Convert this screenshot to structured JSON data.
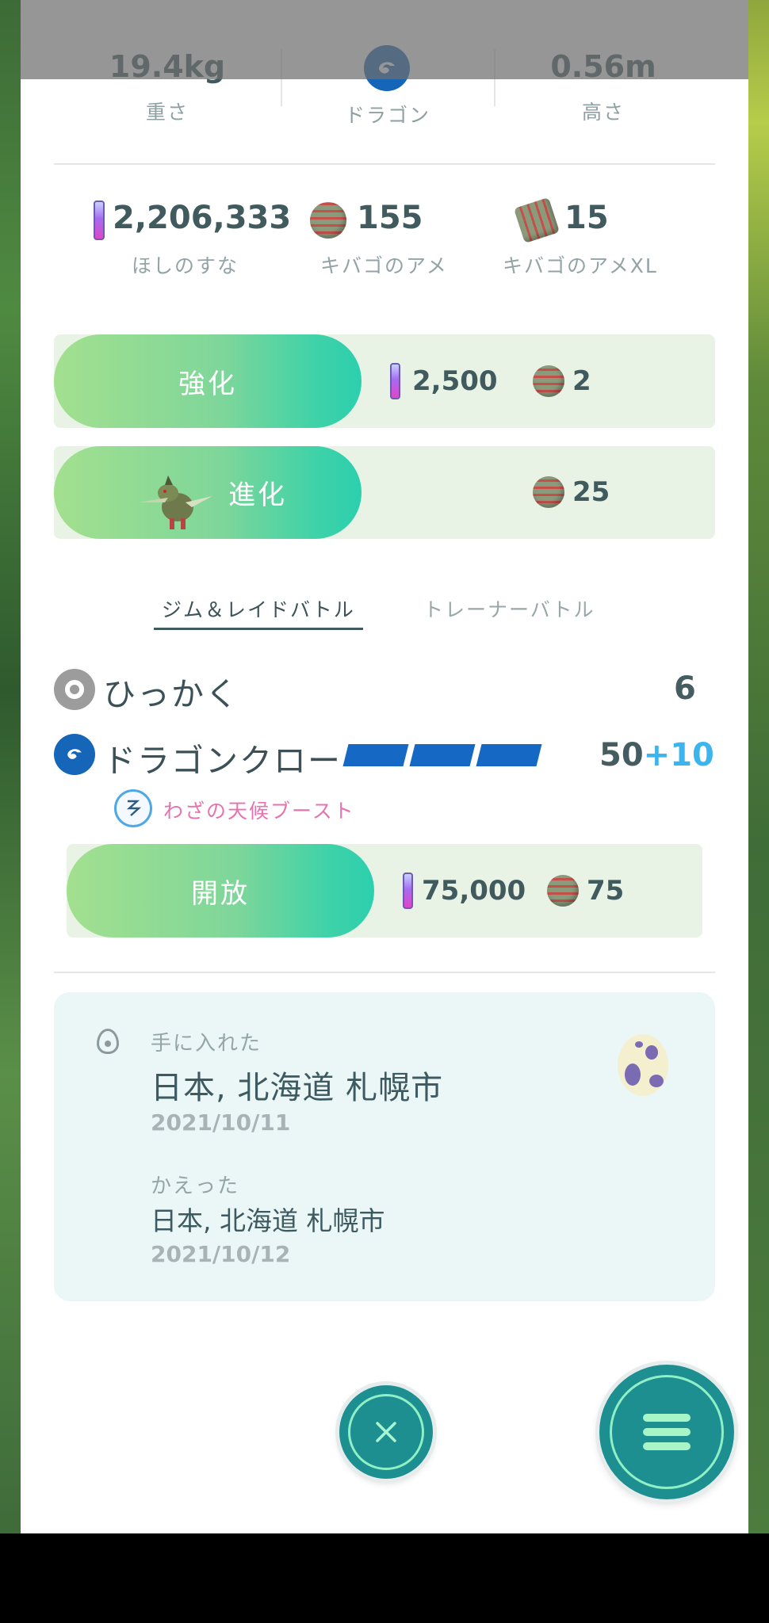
{
  "stats": {
    "weight_value": "19.4kg",
    "weight_label": "重さ",
    "type_label": "ドラゴン",
    "height_value": "0.56m",
    "height_label": "高さ"
  },
  "resources": {
    "stardust_value": "2,206,333",
    "stardust_label": "ほしのすな",
    "candy_value": "155",
    "candy_label": "キバゴのアメ",
    "xl_candy_value": "15",
    "xl_candy_label": "キバゴのアメXL"
  },
  "power_up": {
    "label": "強化",
    "stardust_cost": "2,500",
    "candy_cost": "2"
  },
  "evolve": {
    "label": "進化",
    "candy_cost": "25"
  },
  "tabs": {
    "gym_raid": "ジム＆レイドバトル",
    "trainer": "トレーナーバトル"
  },
  "fast_move": {
    "name": "ひっかく",
    "power": "6"
  },
  "charged_move": {
    "name": "ドラゴンクロー",
    "power": "50",
    "bonus": "+10",
    "weather_boost": "わざの天候ブースト",
    "energy_bars": 3
  },
  "unlock": {
    "label": "開放",
    "stardust_cost": "75,000",
    "candy_cost": "75"
  },
  "origin": {
    "caught_label": "手に入れた",
    "caught_location": "日本, 北海道 札幌市",
    "caught_date": "2021/10/11",
    "hatched_label": "かえった",
    "hatched_location": "日本, 北海道 札幌市",
    "hatched_date": "2021/10/12"
  },
  "icons": {
    "type": "dragon-type-icon",
    "fast_move_type": "normal-type-icon",
    "weather": "windy-weather-icon",
    "close": "close-icon",
    "menu": "menu-icon"
  },
  "colors": {
    "accent_green": "#2ccfae",
    "dragon_blue": "#1565b8",
    "bonus_blue": "#3cb4ee",
    "weather_pink": "#e573b0"
  }
}
